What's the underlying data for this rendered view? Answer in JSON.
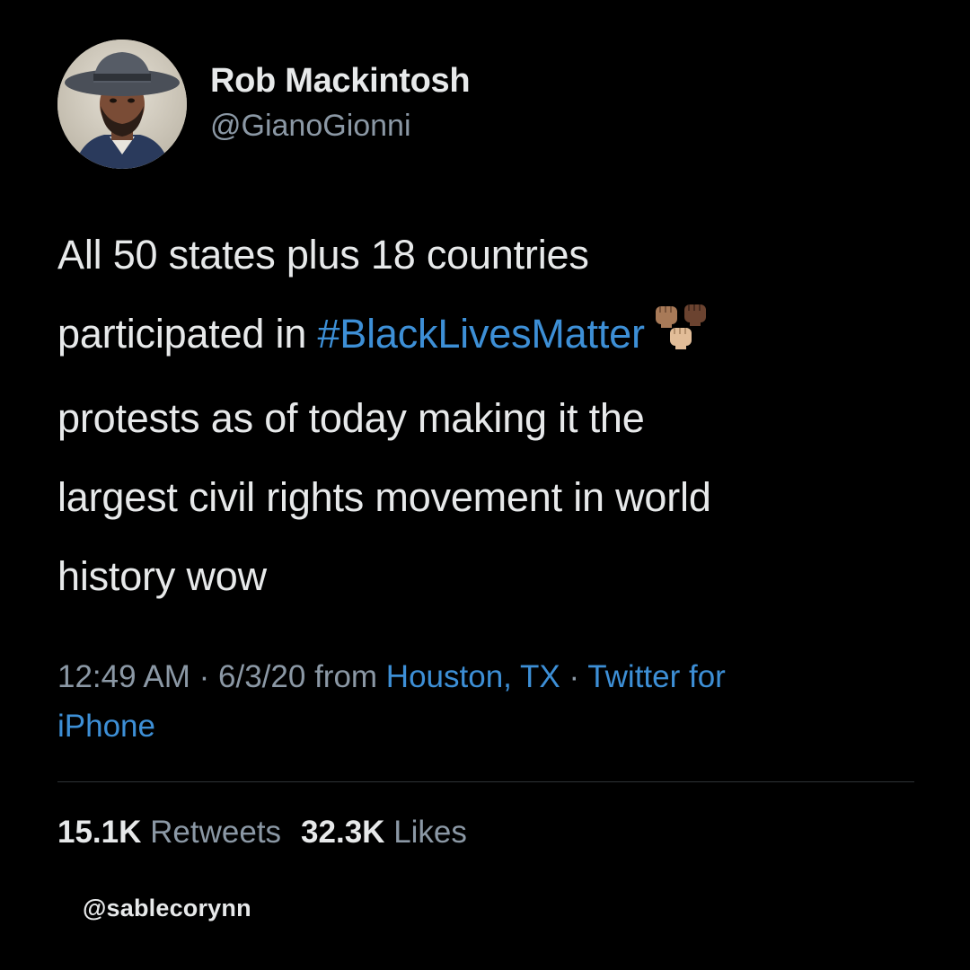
{
  "author": {
    "display_name": "Rob Mackintosh",
    "handle": "@GianoGionni",
    "avatar_icon": "profile-photo-man-in-hat"
  },
  "tweet": {
    "lines": [
      {
        "text": "All 50 states plus 18 countries"
      },
      {
        "before": "participated in ",
        "hashtag": "#BlackLivesMatter",
        "emoji": "raised-fists-emoji"
      },
      {
        "text": "protests as of today making it the"
      },
      {
        "text": "largest civil rights movement in world"
      },
      {
        "text": "history wow"
      }
    ]
  },
  "meta": {
    "time": "12:49 AM",
    "separator": "·",
    "date": "6/3/20",
    "from_label": "from",
    "location": "Houston, TX",
    "source_line1": "Twitter for",
    "source_line2": "iPhone"
  },
  "stats": {
    "retweets_count": "15.1K",
    "retweets_label": "Retweets",
    "likes_count": "32.3K",
    "likes_label": "Likes"
  },
  "watermark": "@sablecorynn",
  "colors": {
    "background": "#000000",
    "text": "#e7e9ea",
    "secondary_text": "#8b98a5",
    "link": "#3d8fd6",
    "divider": "#2f3336"
  }
}
